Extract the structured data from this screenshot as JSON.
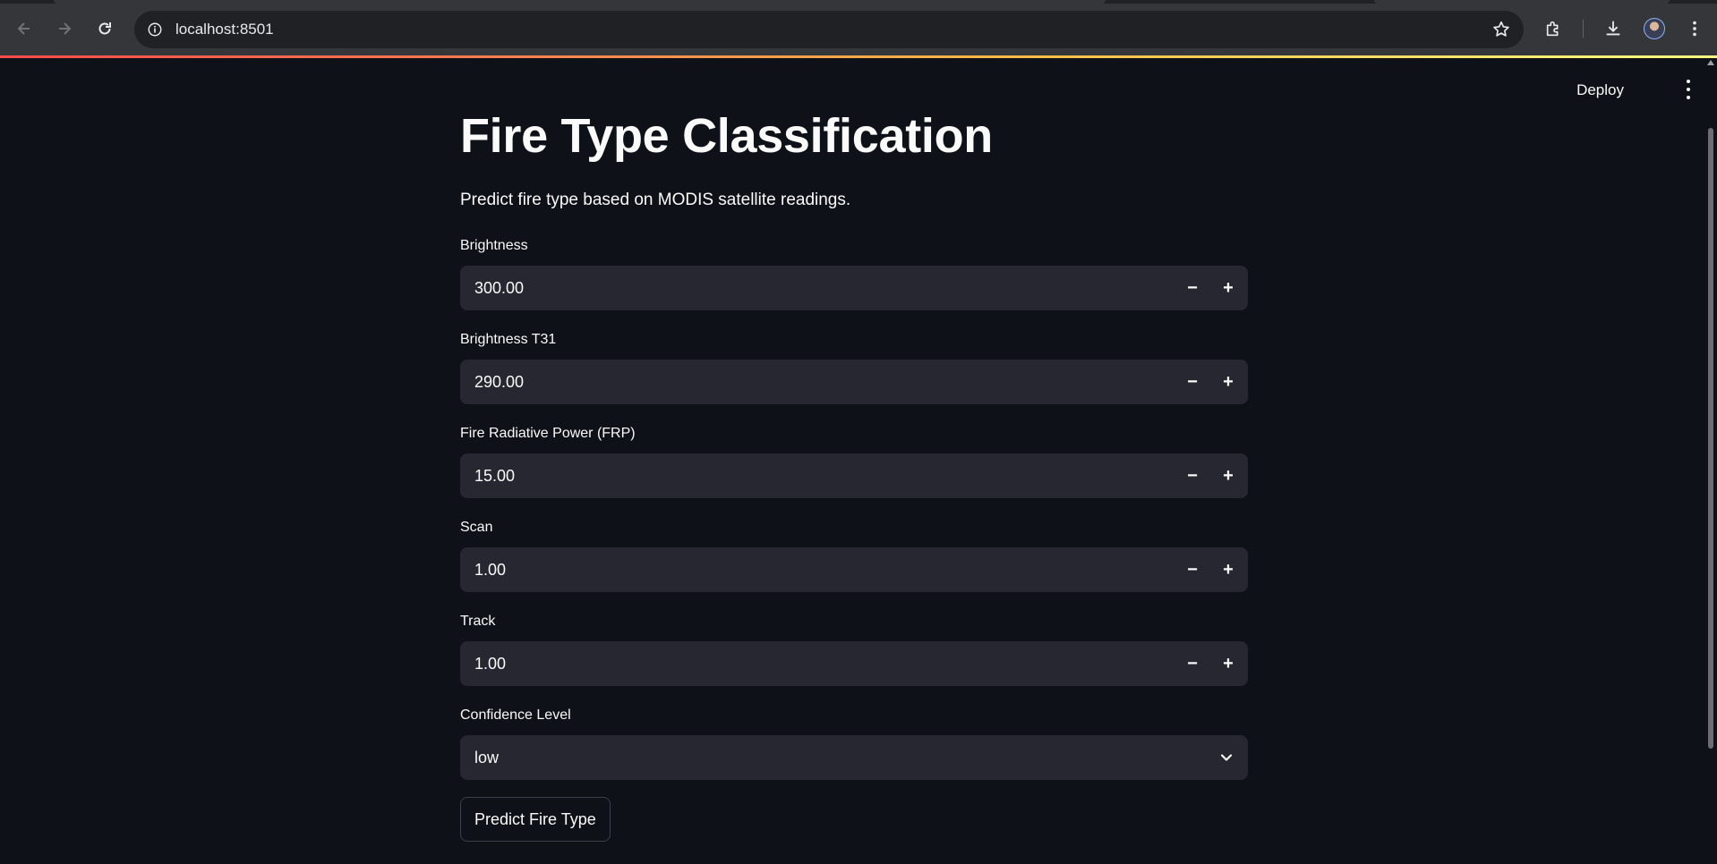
{
  "browser": {
    "url": "localhost:8501"
  },
  "app": {
    "deploy_label": "Deploy",
    "title": "Fire Type Classification",
    "subtitle": "Predict fire type based on MODIS satellite readings.",
    "fields": [
      {
        "label": "Brightness",
        "value": "300.00"
      },
      {
        "label": "Brightness T31",
        "value": "290.00"
      },
      {
        "label": "Fire Radiative Power (FRP)",
        "value": "15.00"
      },
      {
        "label": "Scan",
        "value": "1.00"
      },
      {
        "label": "Track",
        "value": "1.00"
      }
    ],
    "confidence": {
      "label": "Confidence Level",
      "value": "low"
    },
    "predict_label": "Predict Fire Type",
    "stepper": {
      "minus": "−",
      "plus": "+"
    }
  },
  "colors": {
    "background": "#0e1117",
    "input_bg": "#262730",
    "accent": "#ff4b4b"
  }
}
